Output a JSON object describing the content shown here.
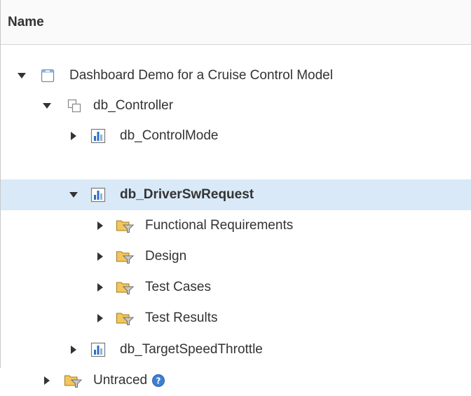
{
  "header": {
    "name_label": "Name"
  },
  "tree": {
    "project": {
      "label": "Dashboard Demo for a Cruise Control Model",
      "icon": "project-icon",
      "expanded": true
    },
    "controller": {
      "label": "db_Controller",
      "icon": "model-reference-icon",
      "expanded": true
    },
    "control_mode": {
      "label": "db_ControlMode",
      "icon": "dashboard-unit-icon",
      "expanded": false
    },
    "driver_sw_request": {
      "label": "db_DriverSwRequest",
      "icon": "dashboard-unit-icon",
      "expanded": true,
      "selected": true
    },
    "functional_requirements": {
      "label": "Functional Requirements",
      "icon": "filter-folder-icon",
      "expanded": false
    },
    "design": {
      "label": "Design",
      "icon": "filter-folder-icon",
      "expanded": false
    },
    "test_cases": {
      "label": "Test Cases",
      "icon": "filter-folder-icon",
      "expanded": false
    },
    "test_results": {
      "label": "Test Results",
      "icon": "filter-folder-icon",
      "expanded": false
    },
    "target_speed_throttle": {
      "label": "db_TargetSpeedThrottle",
      "icon": "dashboard-unit-icon",
      "expanded": false
    },
    "untraced": {
      "label": "Untraced",
      "icon": "filter-folder-icon",
      "expanded": false
    }
  },
  "colors": {
    "selection": "#d9e9f7",
    "text": "#333333",
    "chart_blue": "#2a6fc1",
    "folder": "#f2c65a",
    "help_blue": "#3d7fd0"
  }
}
